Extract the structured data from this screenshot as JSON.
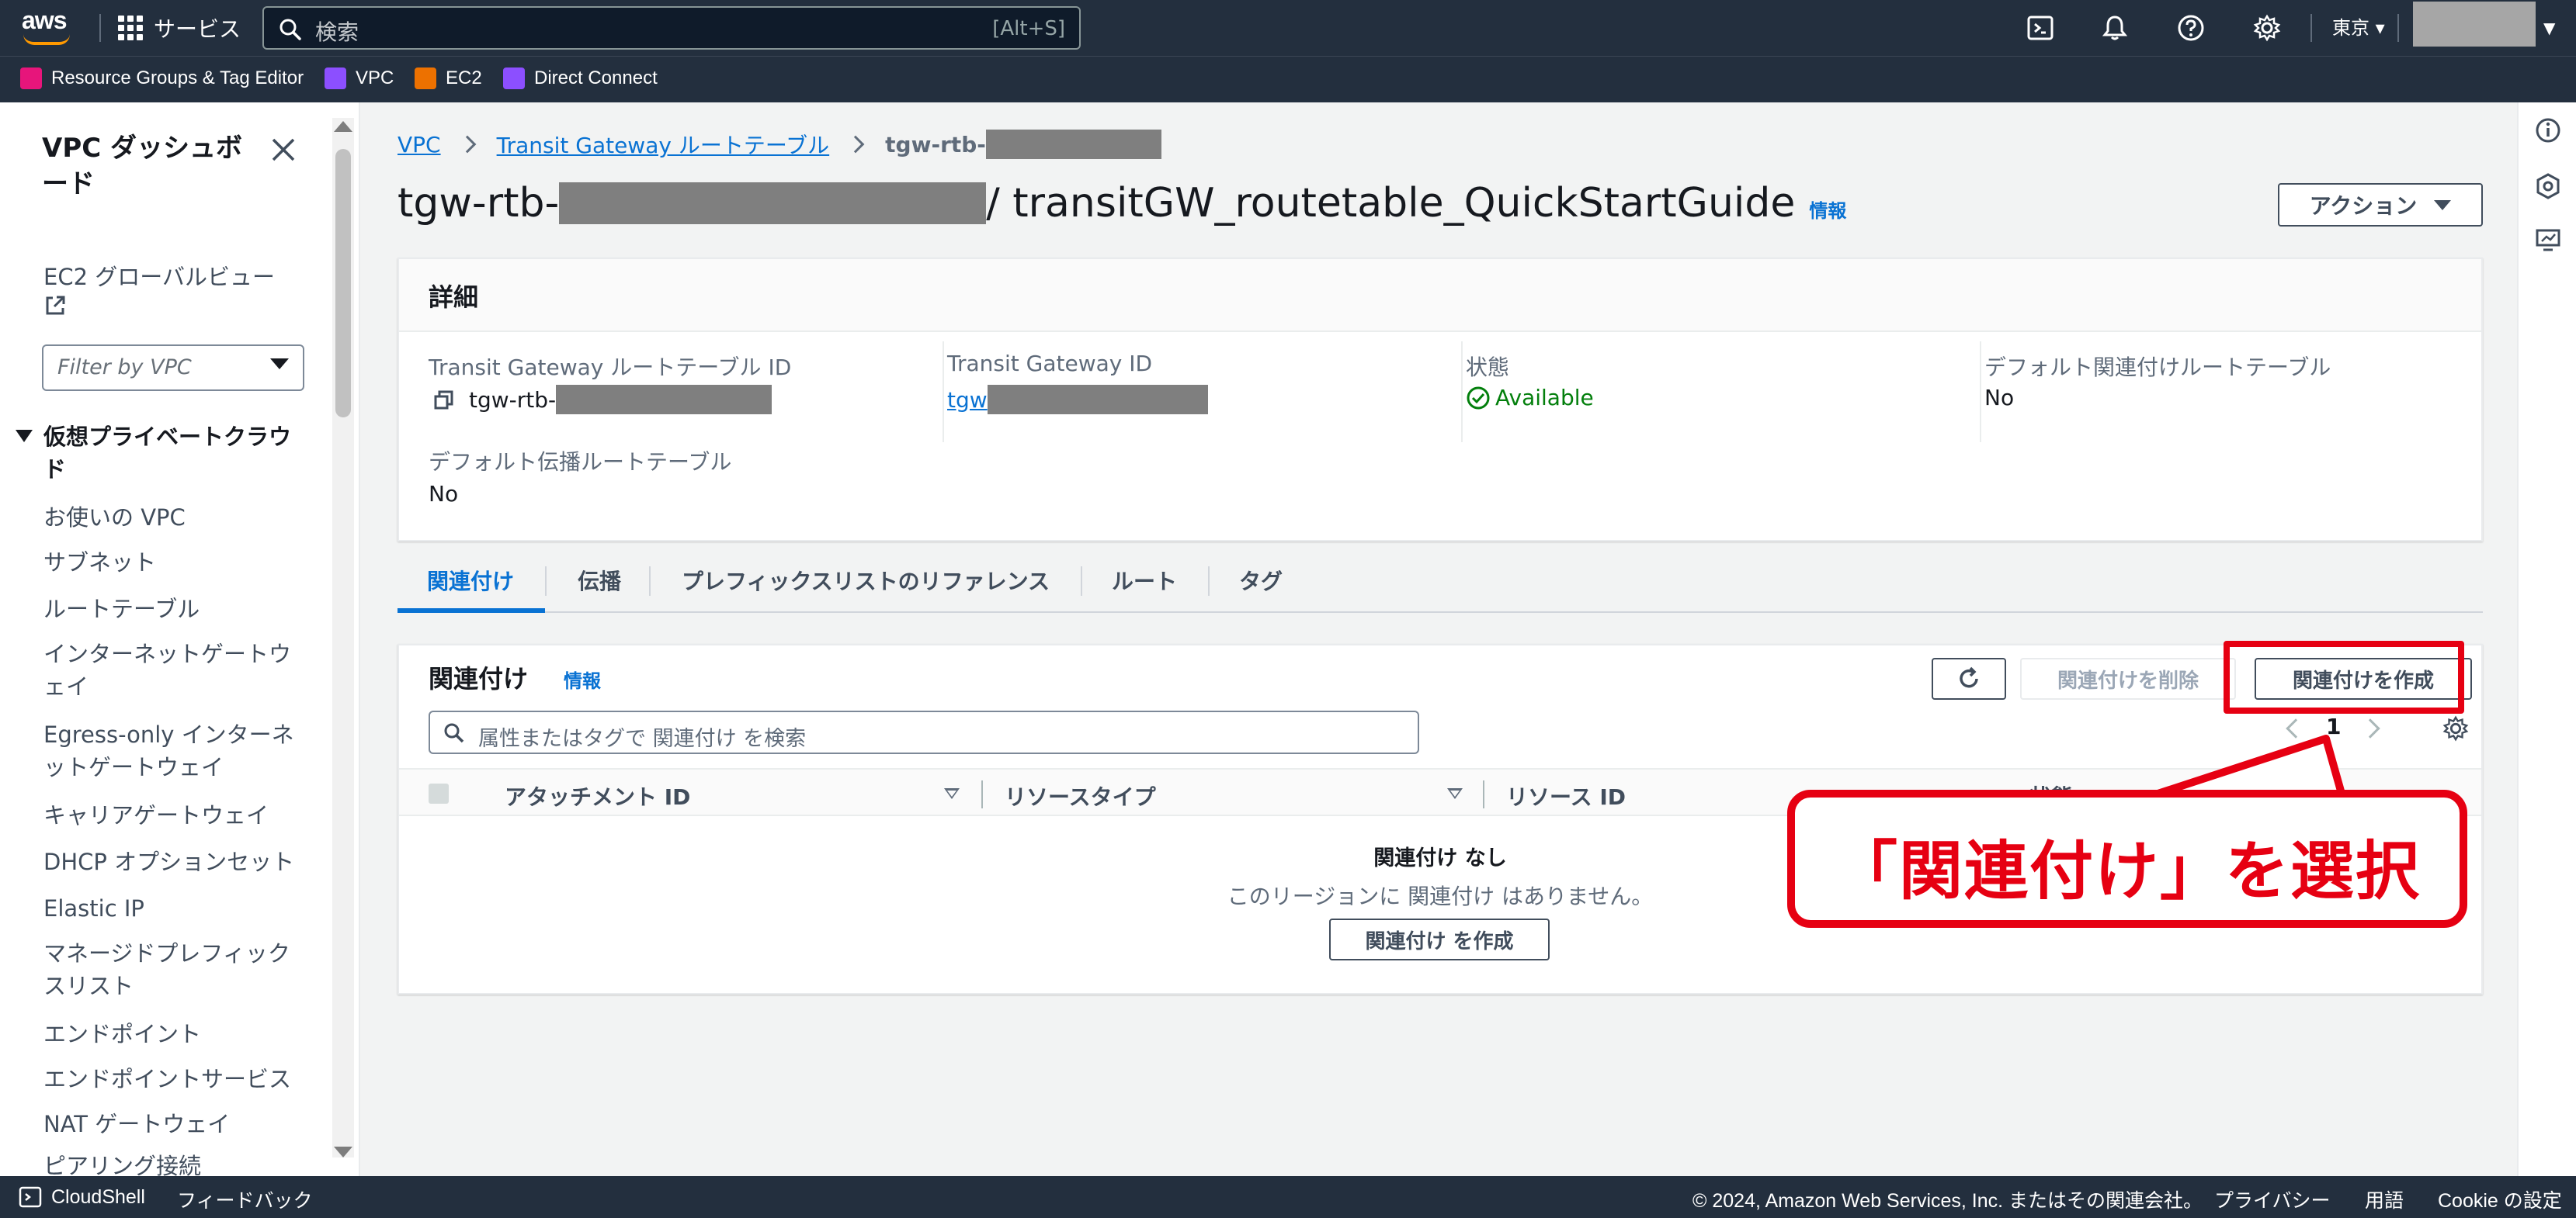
{
  "topnav": {
    "logo": "aws",
    "services_label": "サービス",
    "search_placeholder": "検索",
    "search_shortcut": "[Alt+S]",
    "icons": [
      "cloudshell-icon",
      "bell-icon",
      "help-icon",
      "gear-icon"
    ],
    "region": "東京",
    "account": ""
  },
  "favorites": [
    {
      "label": "Resource Groups & Tag Editor",
      "color": "#e7157b"
    },
    {
      "label": "VPC",
      "color": "#8c4fff"
    },
    {
      "label": "EC2",
      "color": "#ed7100"
    },
    {
      "label": "Direct Connect",
      "color": "#8c4fff"
    }
  ],
  "sidebar": {
    "title": "VPC ダッシュボード",
    "global_view": "EC2 グローバルビュー",
    "filter_placeholder": "Filter by VPC",
    "section": "仮想プライベートクラウド",
    "items": [
      "お使いの VPC",
      "サブネット",
      "ルートテーブル",
      "インターネットゲートウェイ",
      "Egress-only インターネットゲートウェイ",
      "キャリアゲートウェイ",
      "DHCP オプションセット",
      "Elastic IP",
      "マネージドプレフィックスリスト",
      "エンドポイント",
      "エンドポイントサービス",
      "NAT ゲートウェイ",
      "ピアリング接続"
    ]
  },
  "breadcrumb": {
    "vpc": "VPC",
    "tgw_rt": "Transit Gateway ルートテーブル",
    "current_prefix": "tgw-rtb-"
  },
  "page": {
    "title_prefix": "tgw-rtb-",
    "title_suffix": "/ transitGW_routetable_QuickStartGuide",
    "info": "情報",
    "action_button": "アクション"
  },
  "details": {
    "heading": "詳細",
    "fields": {
      "rt_id_label": "Transit Gateway ルートテーブル ID",
      "rt_id_value": "tgw-rtb-",
      "tgw_id_label": "Transit Gateway ID",
      "tgw_id_value": "tgw",
      "state_label": "状態",
      "state_value": "Available",
      "default_assoc_label": "デフォルト関連付けルートテーブル",
      "default_assoc_value": "No",
      "default_prop_label": "デフォルト伝播ルートテーブル",
      "default_prop_value": "No"
    }
  },
  "tabs": [
    "関連付け",
    "伝播",
    "プレフィックスリストのリファレンス",
    "ルート",
    "タグ"
  ],
  "associations": {
    "heading": "関連付け",
    "info": "情報",
    "delete_button": "関連付けを削除",
    "create_button": "関連付けを作成",
    "search_placeholder": "属性またはタグで 関連付け を検索",
    "page": "1",
    "columns": [
      "アタッチメント ID",
      "リソースタイプ",
      "リソース ID",
      "状態"
    ],
    "empty_title": "関連付け なし",
    "empty_subtitle": "このリージョンに 関連付け はありません。",
    "empty_create_button": "関連付け を作成"
  },
  "annotation": {
    "callout_text": "「関連付け」を選択",
    "color": "#e60012"
  },
  "footer": {
    "cloudshell": "CloudShell",
    "feedback": "フィードバック",
    "copyright": "© 2024, Amazon Web Services, Inc. またはその関連会社。",
    "privacy": "プライバシー",
    "terms": "用語",
    "cookie": "Cookie の設定"
  }
}
